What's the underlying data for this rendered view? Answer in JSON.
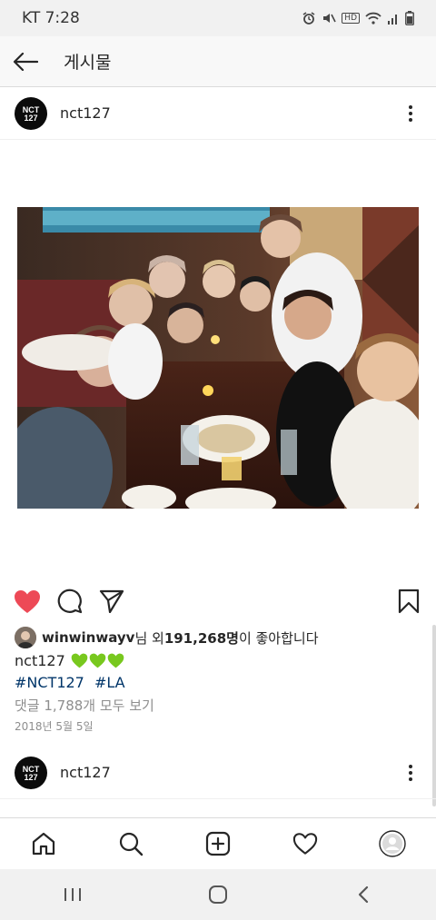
{
  "status": {
    "carrier_time": "KT 7:28",
    "network_badge": "HD"
  },
  "topbar": {
    "title": "게시물"
  },
  "post": {
    "username": "nct127",
    "avatar_text": "NCT 127",
    "likes": {
      "liker": "winwinwayv",
      "mid": "님 외 ",
      "count": "191,268명",
      "suffix": "이 좋아합니다"
    },
    "caption": {
      "username": "nct127",
      "hearts": [
        "💚",
        "💚",
        "💚"
      ]
    },
    "tags": [
      "#NCT127",
      "#LA"
    ],
    "comments_link": "댓글 1,788개 모두 보기",
    "date": "2018년 5월 5일"
  },
  "next_post": {
    "username": "nct127",
    "avatar_text": "NCT 127"
  },
  "colors": {
    "like_red": "#ed4956",
    "hashtag_blue": "#003569",
    "heart_green": "#78c81e"
  }
}
